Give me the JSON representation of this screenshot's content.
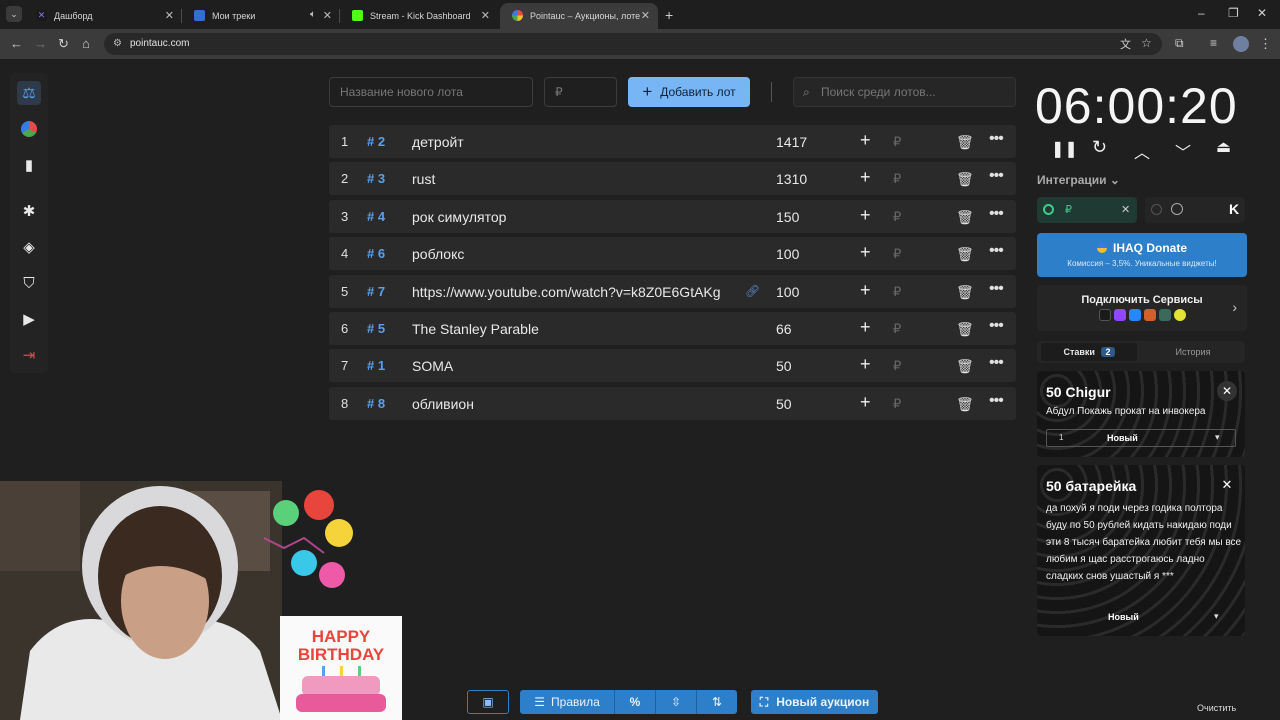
{
  "browser": {
    "tabs": [
      {
        "title": "Дашборд",
        "active": false
      },
      {
        "title": "Мои треки",
        "active": false
      },
      {
        "title": "Stream - Kick Dashboard",
        "active": false
      },
      {
        "title": "Pointauc – Аукционы, лотере",
        "active": true
      }
    ],
    "url": "pointauc.com"
  },
  "toolbar": {
    "lot_name_placeholder": "Название нового лота",
    "amount_placeholder": "₽",
    "add_lot_label": "Добавить лот",
    "search_placeholder": "Поиск среди лотов..."
  },
  "lots": [
    {
      "idx": "1",
      "id": "# 2",
      "name": "детройт",
      "amount": "1417",
      "link": false
    },
    {
      "idx": "2",
      "id": "# 3",
      "name": "rust",
      "amount": "1310",
      "link": false
    },
    {
      "idx": "3",
      "id": "# 4",
      "name": "рок симулятор",
      "amount": "150",
      "link": false
    },
    {
      "idx": "4",
      "id": "# 6",
      "name": "роблокс",
      "amount": "100",
      "link": false
    },
    {
      "idx": "5",
      "id": "# 7",
      "name": "https://www.youtube.com/watch?v=k8Z0E6GtAKg",
      "amount": "100",
      "link": true
    },
    {
      "idx": "6",
      "id": "# 5",
      "name": "The Stanley Parable",
      "amount": "66",
      "link": false
    },
    {
      "idx": "7",
      "id": "# 1",
      "name": "SOMA",
      "amount": "50",
      "link": false
    },
    {
      "idx": "8",
      "id": "# 8",
      "name": "обливион",
      "amount": "50",
      "link": false
    }
  ],
  "lot_currency": "₽",
  "timer": {
    "value": "06:00:20"
  },
  "integrations": {
    "label": "Интеграции",
    "currency": "₽"
  },
  "donate": {
    "title": "IHAQ Donate",
    "subtitle": "Комиссия – 3,5%. Уникальные виджеты!"
  },
  "services": {
    "title": "Подключить Сервисы"
  },
  "bets_tabs": {
    "bets": "Ставки",
    "bets_count": "2",
    "history": "История"
  },
  "bets": [
    {
      "title": "50 Chigur",
      "message": "Абдул Покажь прокат на инвокера",
      "slot": "1",
      "status": "Новый"
    },
    {
      "title": "50 батарейка",
      "message": "да похуй я поди через годика полтора буду по 50 рублей кидать накидаю поди эти 8 тысяч баратейка любит тебя мы все любим я щас расстрогаюсь ладно сладких снов ушастый я ***",
      "status": "Новый"
    }
  ],
  "bottom": {
    "rules": "Правила",
    "new_auction": "Новый аукцион",
    "clear": "Очистить",
    "percent": "%"
  },
  "overlay": {
    "birthday_text": "HAPPY BIRTHDAY"
  },
  "colors": {
    "accent": "#77b5f4",
    "id_blue": "#5aa0ee",
    "donate": "#2d7fc9",
    "bg": "#1f1f1f"
  }
}
